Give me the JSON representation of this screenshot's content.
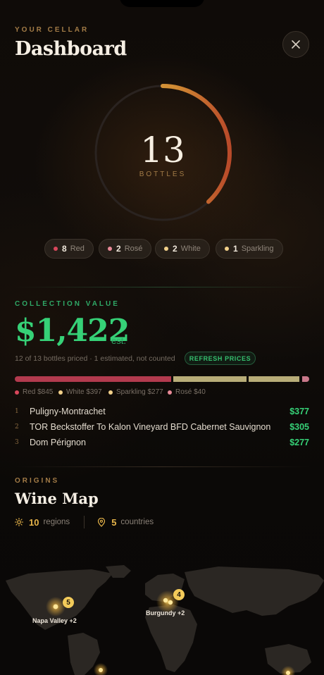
{
  "header": {
    "eyebrow": "YOUR CELLAR",
    "title": "Dashboard",
    "close_icon": "close-icon"
  },
  "bottles": {
    "count": "13",
    "label": "BOTTLES",
    "ring_fill_fraction": 0.38,
    "breakdown": [
      {
        "count": "8",
        "label": "Red",
        "color": "#d9475c"
      },
      {
        "count": "2",
        "label": "Rosé",
        "color": "#e98a98"
      },
      {
        "count": "2",
        "label": "White",
        "color": "#f2d08a"
      },
      {
        "count": "1",
        "label": "Sparkling",
        "color": "#f2d08a"
      }
    ]
  },
  "collection_value": {
    "eyebrow": "COLLECTION VALUE",
    "amount": "$1,422",
    "suffix": "est.",
    "subtitle": "12 of 13 bottles priced · 1 estimated, not counted",
    "refresh_label": "REFRESH PRICES",
    "breakdown": [
      {
        "label": "Red $845",
        "value": 845,
        "color": "#b23a4e"
      },
      {
        "label": "White $397",
        "value": 397,
        "color": "#b8ad78"
      },
      {
        "label": "Sparkling $277",
        "value": 277,
        "color": "#b8ad78"
      },
      {
        "label": "Rosé $40",
        "value": 40,
        "color": "#c9788a"
      }
    ],
    "legend_dot_colors": [
      "#d9475c",
      "#f2d08a",
      "#f2d08a",
      "#e98a98"
    ],
    "top_wines": [
      {
        "rank": "1",
        "name": "Puligny-Montrachet",
        "price": "$377"
      },
      {
        "rank": "2",
        "name": "TOR Beckstoffer To Kalon Vineyard BFD Cabernet Sauvignon",
        "price": "$305"
      },
      {
        "rank": "3",
        "name": "Dom Pérignon",
        "price": "$277"
      }
    ]
  },
  "origins": {
    "eyebrow": "ORIGINS",
    "title": "Wine Map",
    "regions_count": "10",
    "regions_label": "regions",
    "countries_count": "5",
    "countries_label": "countries",
    "clusters": [
      {
        "label": "Napa Valley +2",
        "count": "5"
      },
      {
        "label": "Burgundy +2",
        "count": "4"
      }
    ]
  },
  "colors": {
    "accent_gold": "#e8b54a",
    "value_green": "#36d177"
  }
}
